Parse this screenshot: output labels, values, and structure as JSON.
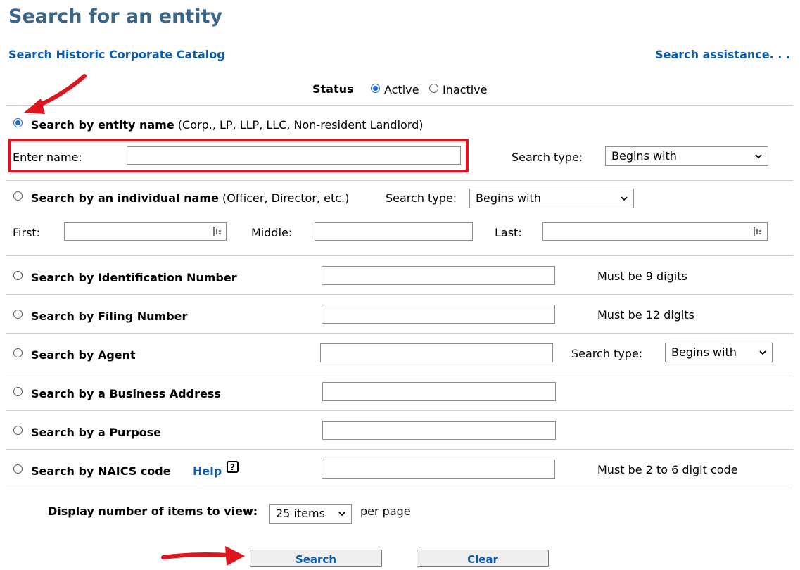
{
  "page": {
    "title": "Search for an entity",
    "historic_link": "Search Historic Corporate Catalog",
    "assistance_link": "Search assistance. . ."
  },
  "status": {
    "label": "Status",
    "options": [
      "Active",
      "Inactive"
    ],
    "selected": "Active"
  },
  "entity_name": {
    "heading": "Search by entity name",
    "note": "(Corp., LP, LLP, LLC, Non-resident Landlord)",
    "input_label": "Enter name:",
    "input_value": "",
    "search_type_label": "Search type:",
    "search_type_value": "Begins with",
    "selected": true
  },
  "individual_name": {
    "heading": "Search by an individual name",
    "note": "(Officer, Director, etc.)",
    "search_type_label": "Search type:",
    "search_type_value": "Begins with",
    "first_label": "First:",
    "middle_label": "Middle:",
    "last_label": "Last:"
  },
  "id_number": {
    "heading": "Search by Identification Number",
    "hint": "Must be 9 digits"
  },
  "filing_number": {
    "heading": "Search by Filing Number",
    "hint": "Must be 12 digits"
  },
  "agent": {
    "heading": "Search by Agent",
    "search_type_label": "Search type:",
    "search_type_value": "Begins with"
  },
  "business_address": {
    "heading": "Search by a Business Address"
  },
  "purpose": {
    "heading": "Search by a Purpose"
  },
  "naics": {
    "heading": "Search by NAICS code",
    "help_label": "Help",
    "help_icon": "?",
    "hint": "Must be 2 to 6 digit code"
  },
  "paging": {
    "label": "Display number of items to view:",
    "value": "25 items",
    "suffix": "per page"
  },
  "actions": {
    "search_label": "Search",
    "clear_label": "Clear"
  },
  "colors": {
    "title": "#3b6589",
    "link": "#0b5cad",
    "annotation": "#e0141e",
    "radio": "#1a6fd6"
  }
}
